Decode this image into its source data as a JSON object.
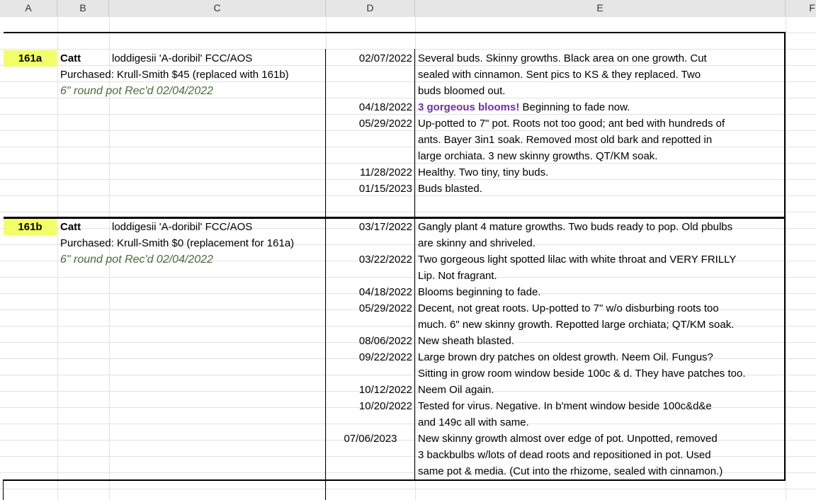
{
  "columns": [
    "A",
    "B",
    "C",
    "D",
    "E",
    "F"
  ],
  "plants": [
    {
      "id": "161a",
      "genus": "Catt",
      "name": "loddigesii 'A-doribil' FCC/AOS",
      "purchased": "Purchased:  Krull-Smith  $45 (replaced with 161b)",
      "pot": "6\" round pot Rec'd 02/04/2022",
      "entries": [
        {
          "date": "02/07/2022",
          "lines": [
            "Several buds.  Skinny growths.  Black area on one growth.  Cut",
            "sealed with cinnamon.  Sent pics to KS & they replaced.  Two",
            "buds bloomed out."
          ]
        },
        {
          "date": "04/18/2022",
          "highlight": "3 gorgeous  blooms!",
          "lines": [
            " Beginning to fade now."
          ]
        },
        {
          "date": "05/29/2022",
          "lines": [
            "Up-potted to 7\" pot.  Roots not too good; ant bed with hundreds of",
            "ants.  Bayer 3in1 soak.  Removed most old bark and repotted in",
            "large orchiata.  3 new skinny growths.  QT/KM soak."
          ]
        },
        {
          "date": "11/28/2022",
          "lines": [
            "Healthy.  Two tiny, tiny buds."
          ]
        },
        {
          "date": "01/15/2023",
          "lines": [
            "Buds blasted."
          ]
        }
      ]
    },
    {
      "id": "161b",
      "genus": "Catt",
      "name": "loddigesii 'A-doribil' FCC/AOS",
      "purchased": "Purchased:  Krull-Smith $0 (replacement for 161a)",
      "pot": "6\" round pot Rec'd 02/04/2022",
      "entries": [
        {
          "date": "03/17/2022",
          "lines": [
            "Gangly plant 4 mature growths.  Two buds ready to pop.  Old pbulbs",
            "are skinny and shriveled."
          ]
        },
        {
          "date": "03/22/2022",
          "lines": [
            "Two gorgeous light spotted lilac with white throat and VERY FRILLY",
            "Lip.  Not fragrant."
          ]
        },
        {
          "date": "04/18/2022",
          "lines": [
            "Blooms beginning to fade."
          ]
        },
        {
          "date": "05/29/2022",
          "lines": [
            "Decent, not great roots.  Up-potted to 7\" w/o disburbing roots too",
            "much.  6\" new skinny growth. Repotted large orchiata; QT/KM soak."
          ]
        },
        {
          "date": "08/06/2022",
          "lines": [
            "New sheath blasted."
          ]
        },
        {
          "date": "09/22/2022",
          "lines": [
            "Large brown dry patches on oldest growth.  Neem Oil.  Fungus?",
            "Sitting in grow room window beside 100c & d.  They have patches too."
          ]
        },
        {
          "date": "10/12/2022",
          "lines": [
            "Neem Oil again."
          ]
        },
        {
          "date": "10/20/2022",
          "lines": [
            "Tested for virus.  Negative.  In b'ment window beside 100c&d&e",
            "and 149c all with same."
          ]
        },
        {
          "date": "07/06/2023",
          "lines": [
            "New skinny growth almost over edge of pot.  Unpotted, removed",
            "3 backbulbs w/lots of dead roots and repositioned in pot.  Used",
            "same pot & media.  (Cut into the rhizome, sealed with cinnamon.)"
          ]
        }
      ]
    }
  ]
}
